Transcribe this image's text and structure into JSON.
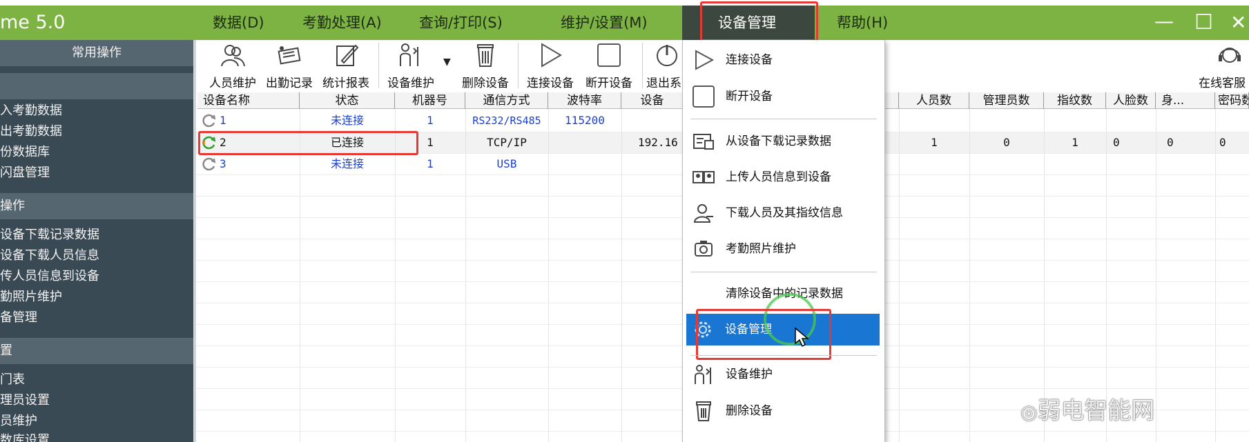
{
  "app": {
    "title": "me 5.0"
  },
  "menu": {
    "items": [
      "数据(D)",
      "考勤处理(A)",
      "查询/打印(S)",
      "维护/设置(M)",
      "设备管理",
      "帮助(H)"
    ]
  },
  "window_controls": {
    "minimize": "—",
    "maximize": "☐",
    "close": "✕"
  },
  "sidebar": {
    "header": "常用操作",
    "groups": [
      {
        "title": "",
        "items": [
          "入考勤数据",
          "出考勤数据",
          "份数据库",
          "闪盘管理"
        ]
      },
      {
        "title": "操作",
        "items": [
          "设备下载记录数据",
          "设备下载人员信息",
          "传人员信息到设备",
          "勤照片维护",
          "备管理"
        ]
      },
      {
        "title": "置",
        "items": [
          "门表",
          "理员设置",
          "员维护",
          "数库设置"
        ]
      }
    ]
  },
  "toolbar": {
    "buttons": [
      {
        "label": "人员维护",
        "icon": "users-icon"
      },
      {
        "label": "出勤记录",
        "icon": "attendance-record-icon"
      },
      {
        "label": "统计报表",
        "icon": "report-icon"
      },
      {
        "label": "设备维护",
        "icon": "device-maintenance-icon"
      },
      {
        "label": "删除设备",
        "icon": "trash-icon"
      },
      {
        "label": "连接设备",
        "icon": "play-icon"
      },
      {
        "label": "断开设备",
        "icon": "stop-icon"
      },
      {
        "label": "退出系",
        "icon": "power-icon"
      },
      {
        "label": "在线客服",
        "icon": "headset-icon"
      }
    ]
  },
  "table": {
    "headers": [
      "设备名称",
      "状态",
      "机器号",
      "通信方式",
      "波特率",
      "设备",
      "人员数",
      "管理员数",
      "指纹数",
      "人脸数",
      "身...",
      "密码数"
    ],
    "rows": [
      {
        "name": "1",
        "status": "未连接",
        "machine": "1",
        "comm": "RS232/RS485",
        "baud": "115200",
        "ip": "",
        "persons": "",
        "admins": "",
        "fingers": "",
        "faces": "",
        "id": "",
        "pwd": ""
      },
      {
        "name": "2",
        "status": "已连接",
        "machine": "1",
        "comm": "TCP/IP",
        "baud": "",
        "ip": "192.16",
        "persons": "1",
        "admins": "0",
        "fingers": "1",
        "faces": "0",
        "id": "0",
        "pwd": "0"
      },
      {
        "name": "3",
        "status": "未连接",
        "machine": "1",
        "comm": "USB",
        "baud": "",
        "ip": "",
        "persons": "",
        "admins": "",
        "fingers": "",
        "faces": "",
        "id": "",
        "pwd": ""
      }
    ]
  },
  "dropdown": {
    "items": [
      "连接设备",
      "断开设备",
      "从设备下载记录数据",
      "上传人员信息到设备",
      "下载人员及其指纹信息",
      "考勤照片维护",
      "清除设备中的记录数据",
      "设备管理",
      "设备维护",
      "删除设备"
    ],
    "selected": "设备管理"
  },
  "watermark": "弱电智能网",
  "colors": {
    "menubar": "#7cb342",
    "sidebar": "#3a4a55",
    "highlight": "#e53935",
    "selected": "#1976d2",
    "link": "#1a3fd1"
  }
}
